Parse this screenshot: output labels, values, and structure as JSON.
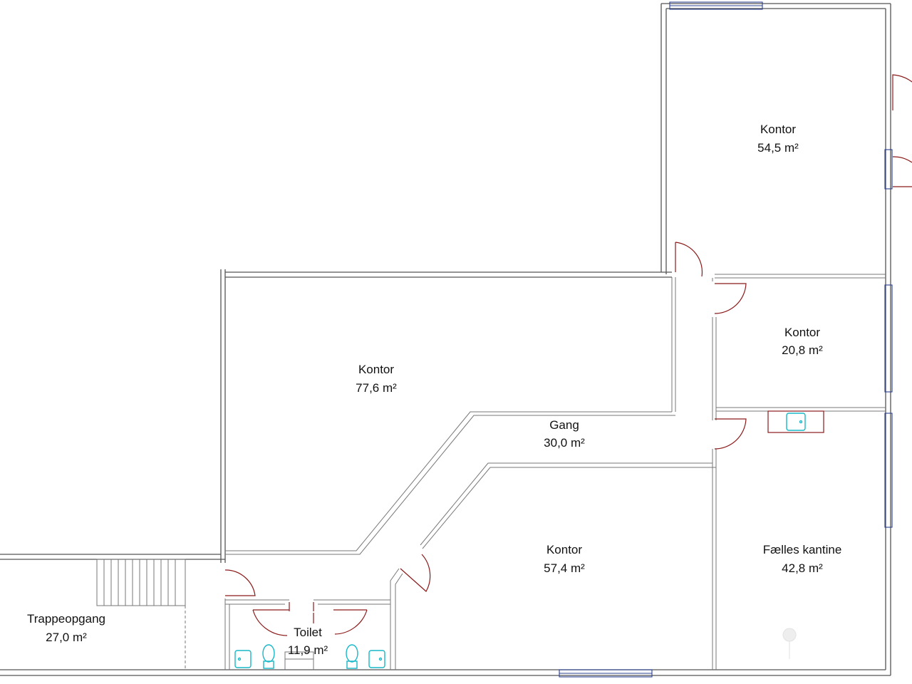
{
  "plan": {
    "rooms": [
      {
        "id": "kontor-54",
        "name": "Kontor",
        "area": "54,5 m²"
      },
      {
        "id": "kontor-20",
        "name": "Kontor",
        "area": "20,8 m²"
      },
      {
        "id": "kontor-77",
        "name": "Kontor",
        "area": "77,6 m²"
      },
      {
        "id": "gang",
        "name": "Gang",
        "area": "30,0 m²"
      },
      {
        "id": "kontor-57",
        "name": "Kontor",
        "area": "57,4 m²"
      },
      {
        "id": "kantine",
        "name": "Fælles kantine",
        "area": "42,8 m²"
      },
      {
        "id": "trappe",
        "name": "Trappeopgang",
        "area": "27,0 m²"
      },
      {
        "id": "toilet",
        "name": "Toilet",
        "area": "11,9 m²"
      }
    ],
    "colors": {
      "wall": "#555555",
      "door": "#8b1a1a",
      "fixture": "#18b8c8",
      "window": "#2a3f8f"
    }
  }
}
